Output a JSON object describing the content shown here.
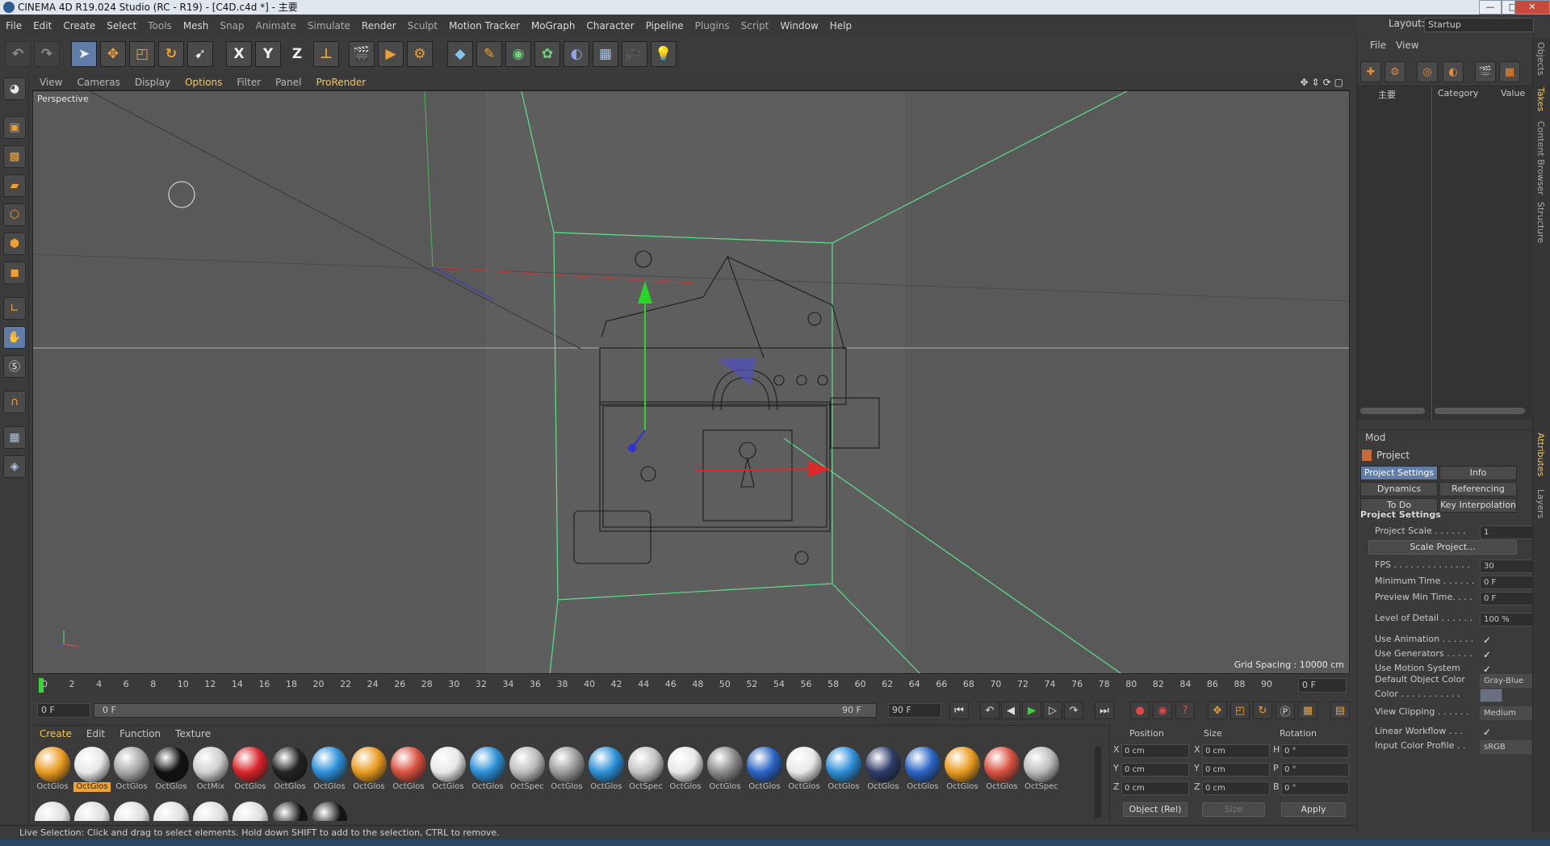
{
  "window": {
    "title": "CINEMA 4D R19.024 Studio (RC - R19) - [C4D.c4d *] - 主要",
    "minimize": "—",
    "maximize": "□",
    "close": "✕"
  },
  "menu": [
    "File",
    "Edit",
    "Create",
    "Select",
    "Tools",
    "Mesh",
    "Snap",
    "Animate",
    "Simulate",
    "Render",
    "Sculpt",
    "Motion Tracker",
    "MoGraph",
    "Character",
    "Pipeline",
    "Plugins",
    "Script",
    "Window",
    "Help"
  ],
  "layout": {
    "label": "Layout:",
    "value": "Startup"
  },
  "toolbar_axes": [
    "X",
    "Y",
    "Z"
  ],
  "viewport": {
    "menu": [
      "View",
      "Cameras",
      "Display",
      "Options",
      "Filter",
      "Panel",
      "ProRender"
    ],
    "active_menu": "Options",
    "label": "Perspective",
    "grid_spacing": "Grid Spacing : 10000 cm"
  },
  "timeline": {
    "ticks": [
      "0",
      "2",
      "4",
      "6",
      "8",
      "10",
      "12",
      "14",
      "16",
      "18",
      "20",
      "22",
      "24",
      "26",
      "28",
      "30",
      "32",
      "34",
      "36",
      "38",
      "40",
      "42",
      "44",
      "46",
      "48",
      "50",
      "52",
      "54",
      "56",
      "58",
      "60",
      "62",
      "64",
      "66",
      "68",
      "70",
      "72",
      "74",
      "76",
      "78",
      "80",
      "82",
      "84",
      "86",
      "88",
      "90"
    ],
    "current_frame": "0 F",
    "start": "0 F",
    "range_start": "0 F",
    "range_end": "90 F",
    "end": "90 F"
  },
  "materials": {
    "menu": [
      "Create",
      "Edit",
      "Function",
      "Texture"
    ],
    "active_menu": "Create",
    "items": [
      {
        "name": "OctGlos",
        "color": "#e89a1e"
      },
      {
        "name": "OctGlos",
        "color": "#e8e8e8",
        "selected": true
      },
      {
        "name": "OctGlos",
        "color": "#a8a8a8"
      },
      {
        "name": "OctGlos",
        "color": "#111111"
      },
      {
        "name": "OctMix",
        "color": "#d0d0d0"
      },
      {
        "name": "OctGlos",
        "color": "#d8242a"
      },
      {
        "name": "OctGlos",
        "color": "#222222"
      },
      {
        "name": "OctGlos",
        "color": "#2b8fd6"
      },
      {
        "name": "OctGlos",
        "color": "#e89a1e"
      },
      {
        "name": "OctGlos",
        "color": "#d8503e"
      },
      {
        "name": "OctGlos",
        "color": "#e8e8e8"
      },
      {
        "name": "OctGlos",
        "color": "#2b8fd6"
      },
      {
        "name": "OctSpec",
        "color": "#bcbcbc"
      },
      {
        "name": "OctGlos",
        "color": "#9a9a9a"
      },
      {
        "name": "OctGlos",
        "color": "#2b8fd6"
      },
      {
        "name": "OctSpec",
        "color": "#c4c4c4"
      },
      {
        "name": "OctGlos",
        "color": "#e8e8e8"
      },
      {
        "name": "OctGlos",
        "color": "#8a8a8a"
      },
      {
        "name": "OctGlos",
        "color": "#2a64c4"
      },
      {
        "name": "OctGlos",
        "color": "#e8e8e8"
      },
      {
        "name": "OctGlos",
        "color": "#2b8fd6"
      },
      {
        "name": "OctGlos",
        "color": "#2c3a66"
      },
      {
        "name": "OctGlos",
        "color": "#2a64c4"
      },
      {
        "name": "OctGlos",
        "color": "#e89a1e"
      },
      {
        "name": "OctGlos",
        "color": "#d8503e"
      },
      {
        "name": "OctSpec",
        "color": "#bcbcbc"
      }
    ]
  },
  "coordinates": {
    "headers": [
      "Position",
      "Size",
      "Rotation"
    ],
    "rows": [
      {
        "axis": "X",
        "pos": "0 cm",
        "size_axis": "X",
        "size": "0 cm",
        "rot_axis": "H",
        "rot": "0 °"
      },
      {
        "axis": "Y",
        "pos": "0 cm",
        "size_axis": "Y",
        "size": "0 cm",
        "rot_axis": "P",
        "rot": "0 °"
      },
      {
        "axis": "Z",
        "pos": "0 cm",
        "size_axis": "Z",
        "size": "0 cm",
        "rot_axis": "B",
        "rot": "0 °"
      }
    ],
    "mode": "Object (Rel)",
    "size_mode": "Size",
    "apply": "Apply"
  },
  "status": "Live Selection: Click and drag to select elements. Hold down SHIFT to add to the selection, CTRL to remove.",
  "objects_panel": {
    "menu": [
      "File",
      "View"
    ],
    "columns": [
      "主要",
      "Category",
      "Value"
    ]
  },
  "attributes": {
    "menu": "Mod",
    "title": "Project",
    "tabs": [
      "Project Settings",
      "Info",
      "Dynamics",
      "Referencing",
      "To Do",
      "Key Interpolation"
    ],
    "section": "Project Settings",
    "scale_label": "Project Scale . . . . . .",
    "scale_value": "1",
    "scale_button": "Scale Project...",
    "fields": [
      {
        "label": "FPS . . . . . . . . . . . . . .",
        "value": "30"
      },
      {
        "label": "Minimum Time . . . . . .",
        "value": "0 F"
      },
      {
        "label": "Preview Min Time. . . .",
        "value": "0 F"
      },
      {
        "label": "Level of Detail . . . . . .",
        "value": "100 %"
      }
    ],
    "checks": [
      {
        "label": "Use Animation . . . . . .",
        "value": "✓"
      },
      {
        "label": "Use Generators . . . . .",
        "value": "✓"
      },
      {
        "label": "Use Motion System",
        "value": "✓"
      }
    ],
    "default_color_label": "Default Object Color",
    "default_color_value": "Gray-Blue",
    "color_label": "Color . . . . . . . . . . .",
    "view_clipping_label": "View Clipping . . . . . .",
    "view_clipping_value": "Medium",
    "linear_workflow_label": "Linear Workflow . . .",
    "linear_workflow_value": "✓",
    "input_profile_label": "Input Color Profile . .",
    "input_profile_value": "sRGB"
  },
  "side_tabs": [
    "Objects",
    "Takes",
    "Content Browser",
    "Structure",
    "Attributes",
    "Layers"
  ],
  "colors": {
    "accent": "#5f7da6",
    "viewport_bg": "#595959",
    "highlight": "#f3c75a"
  }
}
